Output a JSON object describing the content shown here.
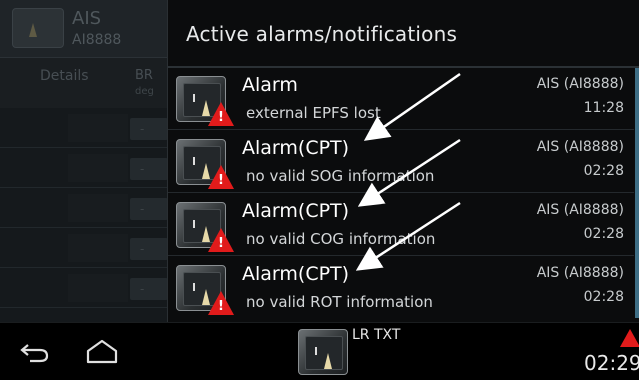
{
  "background": {
    "app_title": "AIS",
    "app_subtitle": "AI8888",
    "tabs": [
      "Details",
      "BR",
      "deg"
    ],
    "row_value": "-"
  },
  "panel": {
    "title": "Active alarms/notifications",
    "items": [
      {
        "title": "Alarm",
        "description": "external EPFS lost",
        "source": "AIS (AI8888)",
        "time": "11:28"
      },
      {
        "title": "Alarm(CPT)",
        "description": "no valid SOG information",
        "source": "AIS (AI8888)",
        "time": "02:28"
      },
      {
        "title": "Alarm(CPT)",
        "description": "no valid COG information",
        "source": "AIS (AI8888)",
        "time": "02:28"
      },
      {
        "title": "Alarm(CPT)",
        "description": "no valid ROT information",
        "source": "AIS (AI8888)",
        "time": "02:28"
      }
    ]
  },
  "navbar": {
    "app_label": "LR TXT",
    "clock": "02:29"
  },
  "icons": {
    "back": "back-icon",
    "home": "home-icon",
    "alarm": "warning-icon",
    "app": "radar-icon"
  },
  "colors": {
    "alarm_red": "#e11b1b",
    "scrollbar": "#3f6f86"
  }
}
